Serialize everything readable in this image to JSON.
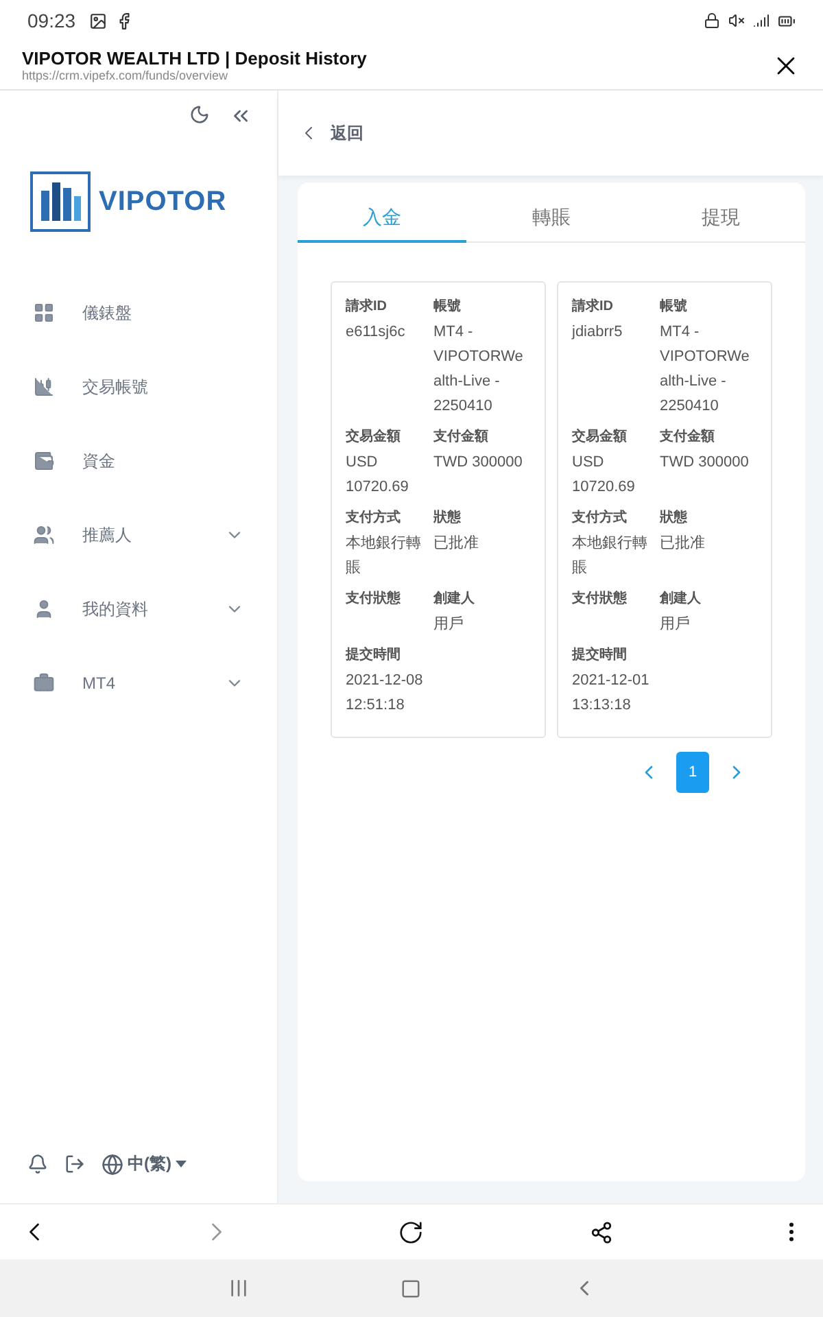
{
  "status_bar": {
    "time": "09:23"
  },
  "browser": {
    "title": "VIPOTOR WEALTH LTD | Deposit History",
    "url": "https://crm.vipefx.com/funds/overview"
  },
  "sidebar": {
    "logo_text": "VIPOTOR",
    "items": [
      {
        "label": "儀錶盤",
        "kind": "dashboard",
        "expandable": false
      },
      {
        "label": "交易帳號",
        "kind": "candles",
        "expandable": false
      },
      {
        "label": "資金",
        "kind": "wallet",
        "expandable": false
      },
      {
        "label": "推薦人",
        "kind": "users",
        "expandable": true
      },
      {
        "label": "我的資料",
        "kind": "user",
        "expandable": true
      },
      {
        "label": "MT4",
        "kind": "case",
        "expandable": true
      }
    ],
    "language": "中(繁)"
  },
  "back_label": "返回",
  "tabs": [
    {
      "label": "入金",
      "selected": true
    },
    {
      "label": "轉賬",
      "selected": false
    },
    {
      "label": "提現",
      "selected": false
    }
  ],
  "records": [
    {
      "fields": [
        {
          "label": "請求ID",
          "value": "e611sj6c"
        },
        {
          "label": "帳號",
          "value": "MT4 - VIPOTORWealth-Live - 2250410"
        },
        {
          "label": "交易金額",
          "value": "USD 10720.69"
        },
        {
          "label": "支付金額",
          "value": "TWD 300000"
        },
        {
          "label": "支付方式",
          "value": "本地銀行轉賬"
        },
        {
          "label": "狀態",
          "value": "已批准"
        },
        {
          "label": "支付狀態"
        },
        {
          "label": "創建人",
          "value": "用戶"
        },
        {
          "label": "提交時間",
          "value": "2021-12-08 12:51:18"
        }
      ]
    },
    {
      "fields": [
        {
          "label": "請求ID",
          "value": "jdiabrr5"
        },
        {
          "label": "帳號",
          "value": "MT4 - VIPOTORWealth-Live - 2250410"
        },
        {
          "label": "交易金額",
          "value": "USD 10720.69"
        },
        {
          "label": "支付金額",
          "value": "TWD 300000"
        },
        {
          "label": "支付方式",
          "value": "本地銀行轉賬"
        },
        {
          "label": "狀態",
          "value": "已批准"
        },
        {
          "label": "支付狀態"
        },
        {
          "label": "創建人",
          "value": "用戶"
        },
        {
          "label": "提交時間",
          "value": "2021-12-01 13:13:18"
        }
      ]
    }
  ],
  "pagination": {
    "pages": [
      {
        "label": "1",
        "selected": true
      }
    ]
  }
}
